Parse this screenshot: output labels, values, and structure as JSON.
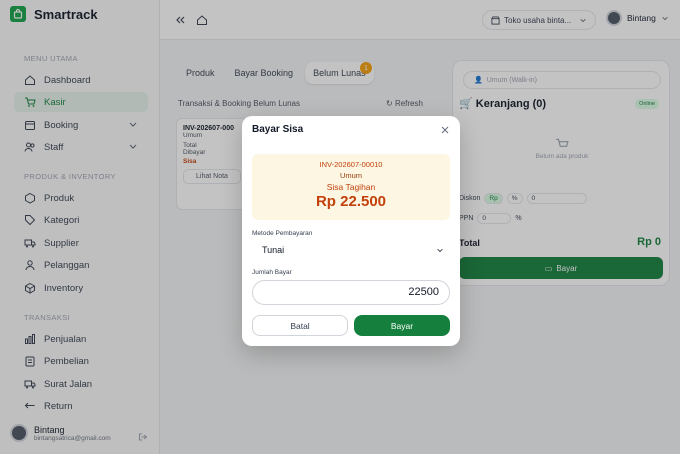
{
  "brand": {
    "name": "Smartrack"
  },
  "sidebar": {
    "section_main": "MENU UTAMA",
    "main_items": [
      {
        "label": "Dashboard",
        "icon": "home-icon"
      },
      {
        "label": "Kasir",
        "icon": "cart-icon",
        "active": true
      },
      {
        "label": "Booking",
        "icon": "calendar-icon",
        "has_chevron": true
      },
      {
        "label": "Staff",
        "icon": "users-icon",
        "has_chevron": true
      }
    ],
    "section_product": "PRODUK & INVENTORY",
    "product_items": [
      {
        "label": "Produk",
        "icon": "box-icon"
      },
      {
        "label": "Kategori",
        "icon": "tag-icon"
      },
      {
        "label": "Supplier",
        "icon": "truck-icon"
      },
      {
        "label": "Pelanggan",
        "icon": "customer-icon"
      },
      {
        "label": "Inventory",
        "icon": "inventory-icon"
      }
    ],
    "section_trans": "TRANSAKSI",
    "trans_items": [
      {
        "label": "Penjualan",
        "icon": "chart-icon"
      },
      {
        "label": "Pembelian",
        "icon": "clipboard-icon"
      },
      {
        "label": "Surat Jalan",
        "icon": "delivery-icon"
      },
      {
        "label": "Return",
        "icon": "return-icon"
      }
    ],
    "user": {
      "name": "Bintang",
      "email": "bintangsatrica@gmail.com"
    }
  },
  "topbar": {
    "store": "Toko usaha binta...",
    "user": "Bintang"
  },
  "main": {
    "tabs": [
      "Produk",
      "Bayar Booking",
      "Belum Lunas"
    ],
    "badge_count": "1",
    "subtitle": "Transaksi & Booking Belum Lunas",
    "refresh_label": "Refresh",
    "invoice_card": {
      "id": "INV-202607-000",
      "customer": "Umum",
      "total_label": "Total",
      "paid_label": "Dibayar",
      "sisa_label": "Sisa",
      "button": "Lihat Nota"
    }
  },
  "cart": {
    "customer_placeholder": "Umum (Walk-in)",
    "title": "Keranjang (0)",
    "status": "Online",
    "empty_text": "Belum ada produk",
    "discount_label": "Diskon",
    "discount_rp": "Rp",
    "discount_pct": "%",
    "discount_value": "0",
    "ppn_label": "PPN",
    "ppn_value": "0",
    "ppn_pct": "%",
    "total_label": "Total",
    "total_value": "Rp 0",
    "pay_button": "Bayar"
  },
  "modal": {
    "title": "Bayar Sisa",
    "invoice": "INV-202607-00010",
    "customer": "Umum",
    "remaining_label": "Sisa Tagihan",
    "remaining_amount": "Rp 22.500",
    "method_label": "Metode Pembayaran",
    "method_value": "Tunai",
    "amount_label": "Jumlah Bayar",
    "amount_value": "22500",
    "cancel_button": "Batal",
    "pay_button": "Bayar"
  },
  "colors": {
    "accent": "#15803d",
    "warning": "#c2410c"
  }
}
